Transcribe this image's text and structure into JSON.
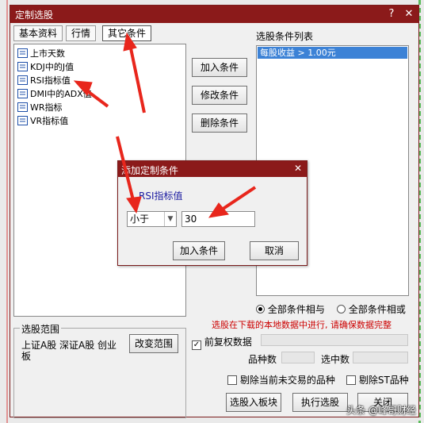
{
  "window": {
    "title": "定制选股",
    "tabs": [
      "基本资料",
      "行情",
      "其它条件"
    ],
    "tree": [
      "上市天数",
      "KDJ中的J值",
      "RSI指标值",
      "DMI中的ADX值",
      "WR指标",
      "VR指标值"
    ],
    "buttons": {
      "add": "加入条件",
      "modify": "修改条件",
      "delete": "删除条件"
    },
    "condition_list_title": "选股条件列表",
    "conditions": [
      "每股收益 > 1.00元"
    ],
    "radio_and": "全部条件相与",
    "radio_or": "全部条件相或",
    "warning": "选股在下载的本地数据中进行, 请确保数据完整",
    "scope_title": "选股范围",
    "scope_text": "上证A股 深证A股 创业板",
    "change_scope": "改变范围",
    "rights_label": "前复权数据",
    "count_label": "品种数",
    "selected_label": "选中数",
    "exclude_untraded": "剔除当前未交易的品种",
    "exclude_st": "剔除ST品种",
    "to_board": "选股入板块",
    "run": "执行选股",
    "close": "关闭"
  },
  "dialog": {
    "title": "添加定制条件",
    "indicator": "RSI指标值",
    "operator": "小于",
    "value": "30",
    "add": "加入条件",
    "cancel": "取消"
  },
  "watermark": "头条 @峰哥财经",
  "colors": {
    "titlebar": "#8b1a1a",
    "selection": "#3c82d6",
    "warning": "#cc0000",
    "arrow": "#e8261c"
  }
}
